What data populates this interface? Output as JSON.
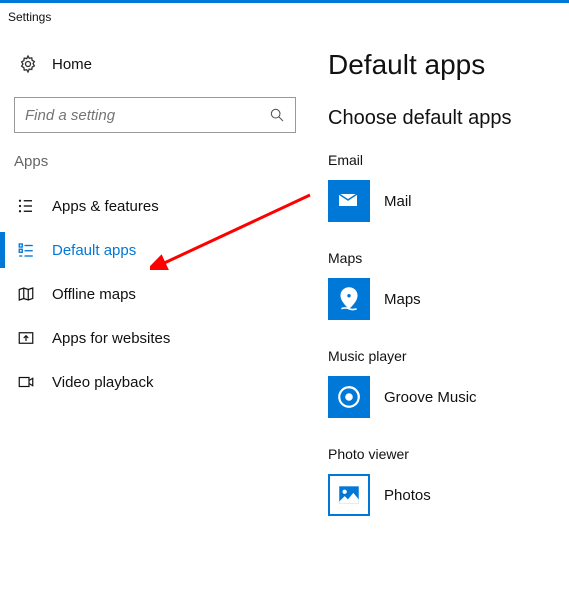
{
  "window_title": "Settings",
  "home_label": "Home",
  "search": {
    "placeholder": "Find a setting"
  },
  "section_label": "Apps",
  "nav": [
    {
      "label": "Apps & features"
    },
    {
      "label": "Default apps"
    },
    {
      "label": "Offline maps"
    },
    {
      "label": "Apps for websites"
    },
    {
      "label": "Video playback"
    }
  ],
  "page_title": "Default apps",
  "subtitle": "Choose default apps",
  "categories": [
    {
      "label": "Email",
      "app": "Mail"
    },
    {
      "label": "Maps",
      "app": "Maps"
    },
    {
      "label": "Music player",
      "app": "Groove Music"
    },
    {
      "label": "Photo viewer",
      "app": "Photos"
    }
  ]
}
